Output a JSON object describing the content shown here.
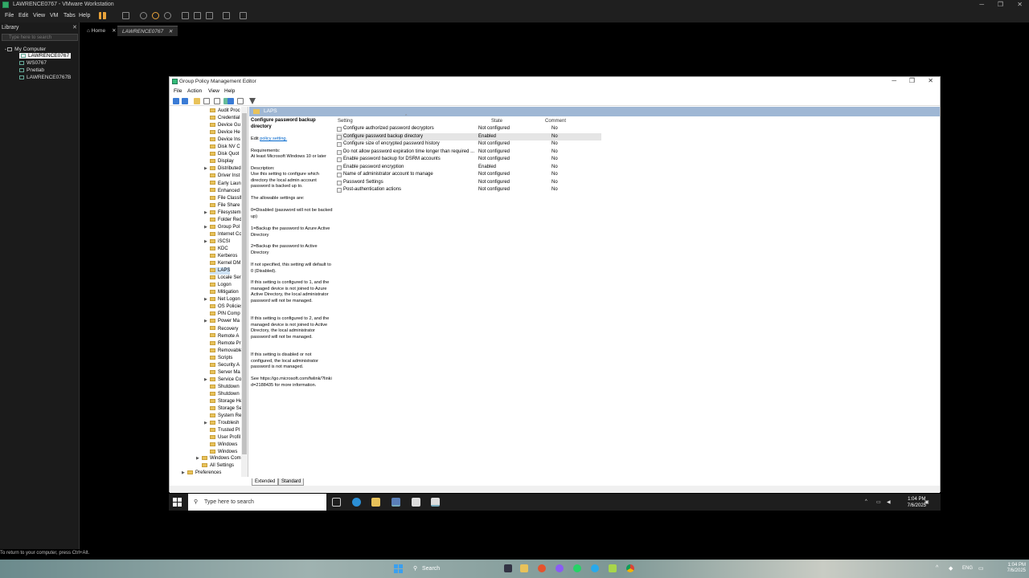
{
  "vm_window": {
    "title": "LAWRENCE0767 - VMware Workstation",
    "menu": [
      "File",
      "Edit",
      "View",
      "VM",
      "Tabs",
      "Help"
    ]
  },
  "library": {
    "header": "Library",
    "search_placeholder": "Type here to search",
    "root": "My Computer",
    "items": [
      "LAWRENCE0767",
      "WS0767",
      "Pnetlab",
      "LAWRENCE0767B"
    ]
  },
  "vm_tabs": [
    "Home",
    "LAWRENCE0767"
  ],
  "vm_status": "To return to your computer, press Ctrl+Alt.",
  "gpe": {
    "title": "Group Policy Management Editor",
    "menu": [
      "File",
      "Action",
      "View",
      "Help"
    ],
    "tree": [
      "Audit Proc",
      "Credential",
      "Device Gu",
      "Device He",
      "Device Ins",
      "Disk NV C",
      "Disk Quot",
      "Display",
      "Distributed",
      "Driver Inst",
      "Early Laun",
      "Enhanced",
      "File Classif",
      "File Share",
      "Filesystem",
      "Folder Red",
      "Group Pol",
      "Internet Co",
      "iSCSI",
      "KDC",
      "Kerberos",
      "Kernel DM",
      "LAPS",
      "Locale Ser",
      "Logon",
      "Mitigation",
      "Net Logon",
      "OS Policies",
      "PIN Comp",
      "Power Ma",
      "Recovery",
      "Remote A",
      "Remote Pr",
      "Removable",
      "Scripts",
      "Security A",
      "Server Ma",
      "Service Co",
      "Shutdown",
      "Shutdown",
      "Storage He",
      "Storage Se",
      "System Re",
      "Troublesh",
      "Trusted Pl",
      "User Profil",
      "Windows",
      "Windows"
    ],
    "tree_lower": [
      "Windows Com",
      "All Settings",
      "Preferences"
    ],
    "selected_folder": "LAPS",
    "desc": {
      "title": "Configure password backup directory",
      "edit_prefix": "Edit ",
      "edit_link": "policy setting.",
      "requirements_label": "Requirements:",
      "requirements": "At least Microsoft Windows 10 or later",
      "description_label": "Description:",
      "p1": "Use this setting to configure which directory the local admin account password is backed up to.",
      "p2": "The allowable settings are:",
      "p3": "0=Disabled (password will not be backed up)",
      "p4": "1=Backup the password to Azure Active Directory",
      "p5": "2=Backup the password to Active Directory",
      "p6": "If not specified, this setting will default to 0 (Disabled).",
      "p7": "If this setting is configured to 1, and the managed device is not joined to Azure Active Directory, the local administrator password will not be managed.",
      "p8": "If this setting is configured to 2, and the managed device is not joined to Active Directory, the local administrator password will not be managed.",
      "p9": "If this setting is disabled or not configured, the local administrator password is not managed.",
      "p10": "See https://go.microsoft.com/fwlink/?linkid=2188435 for more information."
    },
    "columns": {
      "setting": "Setting",
      "state": "State",
      "comment": "Comment"
    },
    "rows": [
      {
        "name": "Configure authorized password decryptors",
        "state": "Not configured",
        "comment": "No"
      },
      {
        "name": "Configure password backup directory",
        "state": "Enabled",
        "comment": "No"
      },
      {
        "name": "Configure size of encrypted password history",
        "state": "Not configured",
        "comment": "No"
      },
      {
        "name": "Do not allow password expiration time longer than required ...",
        "state": "Not configured",
        "comment": "No"
      },
      {
        "name": "Enable password backup for DSRM accounts",
        "state": "Not configured",
        "comment": "No"
      },
      {
        "name": "Enable password encryption",
        "state": "Enabled",
        "comment": "No"
      },
      {
        "name": "Name of administrator account to manage",
        "state": "Not configured",
        "comment": "No"
      },
      {
        "name": "Password Settings",
        "state": "Not configured",
        "comment": "No"
      },
      {
        "name": "Post-authentication actions",
        "state": "Not configured",
        "comment": "No"
      }
    ],
    "tabs": [
      "Extended",
      "Standard"
    ]
  },
  "guest_taskbar": {
    "search": "Type here to search",
    "time": "1:04 PM",
    "date": "7/6/2025"
  },
  "host_taskbar": {
    "search": "Search",
    "lang": "ENG",
    "time": "1:04 PM",
    "date": "7/6/2025"
  }
}
